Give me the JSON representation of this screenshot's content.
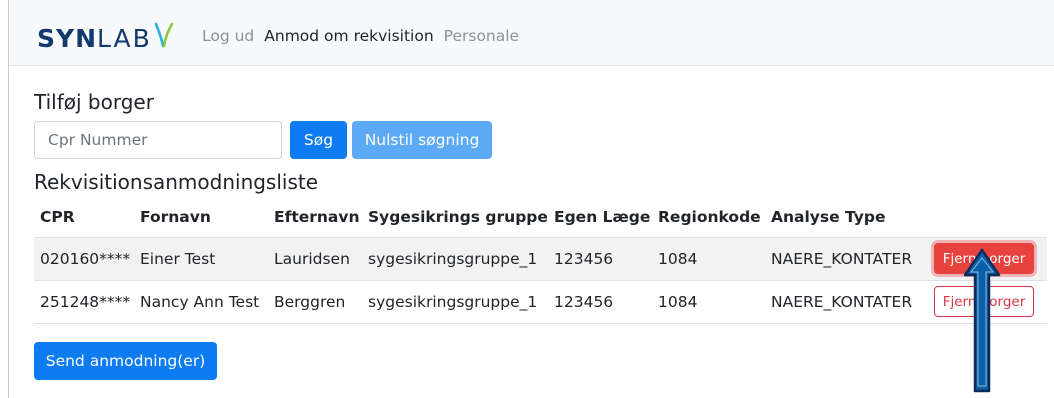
{
  "navbar": {
    "brand": {
      "bold": "SYN",
      "light": "LAB"
    },
    "links": [
      {
        "label": "Log ud",
        "active": false
      },
      {
        "label": "Anmod om rekvisition",
        "active": true
      },
      {
        "label": "Personale",
        "active": false
      }
    ]
  },
  "add_section": {
    "title": "Tilføj borger",
    "cpr_placeholder": "Cpr Nummer",
    "cpr_value": "",
    "search_label": "Søg",
    "reset_label": "Nulstil søgning"
  },
  "list_section": {
    "title": "Rekvisitionsanmodningsliste",
    "columns": [
      "CPR",
      "Fornavn",
      "Efternavn",
      "Sygesikrings gruppe",
      "Egen Læge",
      "Regionkode",
      "Analyse Type",
      ""
    ],
    "rows": [
      {
        "cpr": "020160****",
        "fornavn": "Einer Test",
        "efternavn": "Lauridsen",
        "gruppe": "sygesikringsgruppe_1",
        "egen_laege": "123456",
        "regionkode": "1084",
        "analyse": "NAERE_KONTATER",
        "action": "Fjern borger"
      },
      {
        "cpr": "251248****",
        "fornavn": "Nancy Ann Test",
        "efternavn": "Berggren",
        "gruppe": "sygesikringsgruppe_1",
        "egen_laege": "123456",
        "regionkode": "1084",
        "analyse": "NAERE_KONTATER",
        "action": "Fjern borger"
      }
    ],
    "send_label": "Send anmodning(er)"
  },
  "colors": {
    "primary": "#0d7bf2",
    "primary_light": "#5ca9f6",
    "danger": "#e8423f",
    "brand": "#123a6d",
    "arrow": "#0b5fa8"
  }
}
